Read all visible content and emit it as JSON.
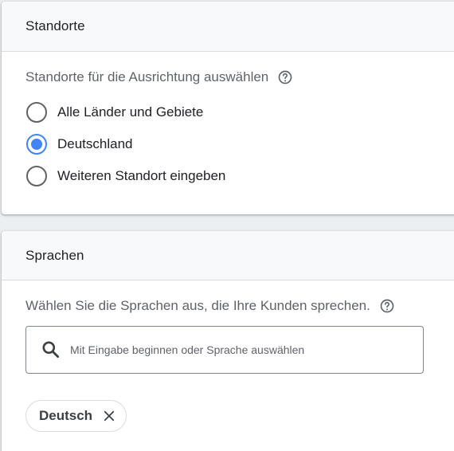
{
  "locations": {
    "title": "Standorte",
    "question": "Standorte für die Ausrichtung auswählen",
    "options": [
      {
        "label": "Alle Länder und Gebiete",
        "selected": false
      },
      {
        "label": "Deutschland",
        "selected": true
      },
      {
        "label": "Weiteren Standort eingeben",
        "selected": false
      }
    ]
  },
  "languages": {
    "title": "Sprachen",
    "question": "Wählen Sie die Sprachen aus, die Ihre Kunden sprechen.",
    "search": {
      "value": "",
      "placeholder": "Mit Eingabe beginnen oder Sprache auswählen"
    },
    "chips": [
      {
        "label": "Deutsch"
      }
    ]
  },
  "colors": {
    "accent": "#4285f4",
    "header_bg": "#f8f9fa",
    "text_primary": "#202124",
    "text_secondary": "#5f6368"
  },
  "icons": {
    "help": "help-circle-icon",
    "search": "search-icon",
    "chip_remove": "close-icon"
  }
}
